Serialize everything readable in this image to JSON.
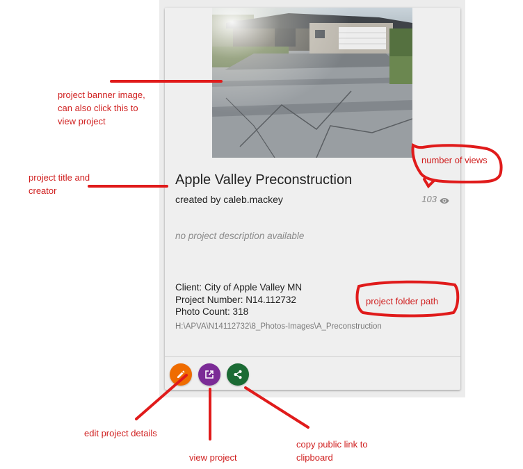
{
  "project_card": {
    "title": "Apple Valley Preconstruction",
    "creator": "created by caleb.mackey",
    "views": "103",
    "description": "no project description available",
    "client": "Client: City of Apple Valley MN",
    "project_number": "Project Number: N14.112732",
    "photo_count": "Photo Count: 318",
    "folder_path": "H:\\APVA\\N14112732\\8_Photos-Images\\A_Preconstruction",
    "actions": {
      "edit_color": "#ef6c00",
      "view_color": "#7b2b96",
      "share_color": "#1b6b34"
    }
  },
  "annotations": {
    "banner": [
      "project banner image,",
      "can also click this to",
      "view project"
    ],
    "title": [
      "project title and",
      "creator"
    ],
    "views": "number of views",
    "folder": "project folder path",
    "edit": "edit project details",
    "view": "view project",
    "share": [
      "copy public link to",
      "clipboard"
    ],
    "color": "#d01f1f"
  }
}
